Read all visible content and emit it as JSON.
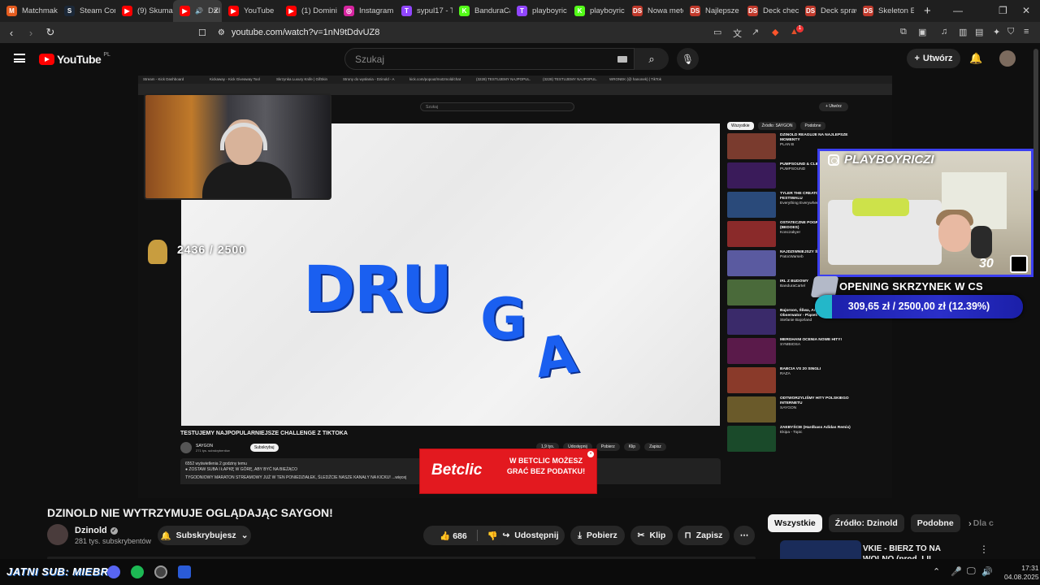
{
  "browser": {
    "tabs": [
      {
        "label": "Matchmaki",
        "color": "#e55c1f",
        "glyph": "M"
      },
      {
        "label": "Steam Com",
        "color": "#1b2838",
        "glyph": "S"
      },
      {
        "label": "(9) Skuma",
        "color": "#ff0000",
        "glyph": "▶"
      },
      {
        "label": "DZI",
        "color": "#ff0000",
        "glyph": "▶",
        "active": true
      },
      {
        "label": "YouTube",
        "color": "#ff0000",
        "glyph": "▶"
      },
      {
        "label": "(1) Domini",
        "color": "#ff0000",
        "glyph": "▶"
      },
      {
        "label": "Instagram",
        "color": "#d6249f",
        "glyph": "◎"
      },
      {
        "label": "sypul17 - T",
        "color": "#9146ff",
        "glyph": "T"
      },
      {
        "label": "BanduraCa",
        "color": "#53fc18",
        "glyph": "K"
      },
      {
        "label": "playboyric",
        "color": "#9146ff",
        "glyph": "T"
      },
      {
        "label": "playboyric",
        "color": "#53fc18",
        "glyph": "K"
      },
      {
        "label": "Nowa mete",
        "color": "#c0392b",
        "glyph": "DS"
      },
      {
        "label": "Najlepsze",
        "color": "#c0392b",
        "glyph": "DS"
      },
      {
        "label": "Deck chec",
        "color": "#c0392b",
        "glyph": "DS"
      },
      {
        "label": "Deck spraw",
        "color": "#c0392b",
        "glyph": "DS"
      },
      {
        "label": "Skeleton E",
        "color": "#c0392b",
        "glyph": "DS"
      }
    ],
    "url": "youtube.com/watch?v=1nN9tDdvUZ8",
    "brave_badge": "1"
  },
  "youtube": {
    "logo": "YouTube",
    "country": "PL",
    "search_placeholder": "Szukaj",
    "create_label": "Utwórz"
  },
  "player": {
    "inner_tabs": [
      "Stream - Kick Dashboard",
      "Kickaway - Kick Giveaway Tool",
      "Skrzynka Luxury Knife | GifSkin",
      "Strony do wysłania - Dzinold - A",
      "kick.com/popout/motzmold/chat",
      "(3228) TESTUJEMY NAJPOPUL.",
      "(3228) TESTUJEMY NAJPOPUL.",
      "WRONEK (@ hanonek) | TikTok"
    ],
    "inner_search": "Szukaj",
    "inner_create": "+ Utwórz",
    "video_text_1": "DRU",
    "video_text_2": "G",
    "video_text_3": "A",
    "counter": "2436 / 2500",
    "inner_chips": [
      "Wszystkie",
      "Źródło: SAYGON",
      "Podobne"
    ],
    "inner_recs": [
      {
        "title": "DZINOLD REAGUJE NA NAJLEPSZE MOMENTY",
        "meta": "PLAN B",
        "color": "#7a3b2e"
      },
      {
        "title": "PUMPSOUND & CLIP Like This",
        "meta": "PUMPSOUND",
        "color": "#3a1b5a"
      },
      {
        "title": "TYLER THE CREATOR 4K NA FESTIWALU",
        "meta": "Everything Everywhere",
        "color": "#2a4a7a"
      },
      {
        "title": "OSTATECZNE POGROMY MASTIF (BEDOES)",
        "meta": "Konczakyer",
        "color": "#8a2a2a"
      },
      {
        "title": "NAJDZIWNIEJSZY ŚWIECIE",
        "meta": "PatocWarseb",
        "color": "#5a5aa0"
      },
      {
        "title": "IRL Z BUDOWY",
        "meta": "BanduraCartel",
        "color": "#4a6a3a"
      },
      {
        "title": "Bajorson, Śliwa, AnnaKrux, Dawid Obserwator - Piąsek",
        "meta": "Stefanie Bajorland",
        "color": "#3a2a6a"
      },
      {
        "title": "MERGHANI OCENIA NOWE HITY!",
        "meta": "SYMBIOSA",
        "color": "#5a1a4a"
      },
      {
        "title": "BABCIA VS 20 SINGLI",
        "meta": "RAZA",
        "color": "#8a3a2a"
      },
      {
        "title": "ODTWORZYLIŚMY HITY POLSKIEGO INTERNETU",
        "meta": "SAYGON",
        "color": "#6a5a2a"
      },
      {
        "title": "ZAEBYŚCIE (Hardbass Adidas Remix)",
        "meta": "Ekipa - Topic",
        "color": "#1a4a2a"
      }
    ],
    "inner_title": "TESTUJEMY NAJPOPULARNIEJSZE CHALLENGE Z TIKTOKA",
    "inner_channel": "SAYGON",
    "inner_channel_subs": "271 tys. subskrybentów",
    "inner_subscribe": "Subskrybuj",
    "inner_actions": [
      "1,9 tys.",
      "Udostępnij",
      "Pobierz",
      "Klip",
      "Zapisz"
    ],
    "inner_desc_1": "6552 wyświetlenia  2 godziny temu",
    "inner_desc_2": "● ZOSTAW SUBA I ŁAPKĘ W GÓRĘ, ABY BYĆ NA BIEŻĄCO",
    "inner_desc_3": "TYGODNIOWY MARATON STREAMOWY JUŻ W TEN PONIEDZIAŁEK, ŚLEDŹCIE NASZE KANAŁY NA KICKU! ...więcej",
    "ad_brand": "Betclic",
    "ad_text": "W BETCLIC MOŻESZ GRAĆ BEZ PODATKU!"
  },
  "overlay": {
    "ig_handle": "PLAYBOYRICZI",
    "cam_number": "30",
    "goal_title": "OPENING SKRZYNEK W CS",
    "goal_text": "309,65 zł / 2500,00 zł (12.39%)",
    "goal_fraction": 0.1239
  },
  "video": {
    "title": "DZINOLD NIE WYTRZYMUJE OGLĄDAJĄC SAYGON!",
    "channel": "Dzinold",
    "subs": "281 tys. subskrybentów",
    "subscribe_label": "Subskrybujesz",
    "likes": "686",
    "share": "Udostępnij",
    "download": "Pobierz",
    "clip": "Klip",
    "save": "Zapisz"
  },
  "sidebar": {
    "chips": [
      "Wszystkie",
      "Źródło: Dzinold",
      "Podobne",
      "Dla c"
    ],
    "next_title": "VKIE - BIERZ TO NA WOLNO (prod. LIL SANTIAGO) | ..."
  },
  "taskbar": {
    "ticker": "JATNI SUB: MIEBRU",
    "time": "17:31",
    "date": "04.08.2025"
  }
}
